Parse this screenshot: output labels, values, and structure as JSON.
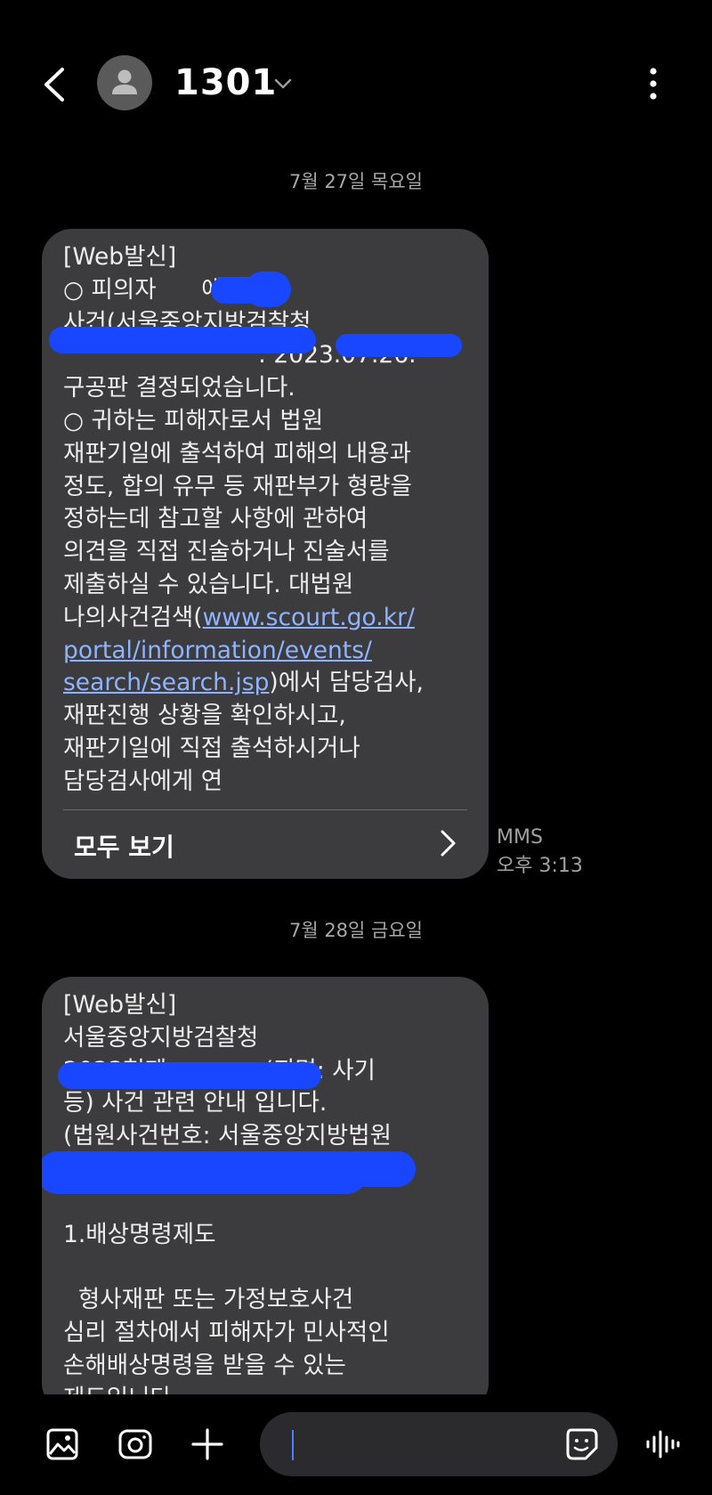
{
  "header": {
    "contact_name": "1301",
    "icons": {
      "back": "back-arrow-icon",
      "avatar": "person-icon",
      "expand": "chevron-down-icon",
      "more": "more-vertical-icon"
    }
  },
  "thread": [
    {
      "date": "7월 27일 목요일",
      "message": {
        "text_before_link": "[Web발신]\n○ 피의자      에 대한\n사건(서울중앙지방검찰청\n                          : 2023.07.26.\n구공판 결정되었습니다.\n○ 귀하는 피해자로서 법원\n재판기일에 출석하여 피해의 내용과\n정도, 합의 유무 등 재판부가 형량을\n정하는데 참고할 사항에 관하여\n의견을 직접 진술하거나 진술서를\n제출하실 수 있습니다. 대법원\n나의사건검색(",
        "link": "www.scourt.go.kr/\nportal/information/events/\nsearch/search.jsp",
        "text_after_link": ")에서 담당검사,\n재판진행 상황을 확인하시고,\n재판기일에 직접 출석하시거나\n담당검사에게 연",
        "see_all_label": "모두 보기",
        "type_label": "MMS",
        "time": "오후 3:13"
      }
    },
    {
      "date": "7월 28일 금요일",
      "message": {
        "text": "[Web발신]\n서울중앙지방검찰청\n2023형제             (죄명: 사기\n등) 사건 관련 안내 입니다.\n(법원사건번호: 서울중앙지방법원\n\n\n1.배상명령제도\n\n  형사재판 또는 가정보호사건\n심리 절차에서 피해자가 민사적인\n손해배상명령을 받을 수 있는\n제도입니다."
      }
    }
  ],
  "composer": {
    "placeholder": "",
    "icons": {
      "gallery": "gallery-icon",
      "camera": "camera-icon",
      "add": "plus-icon",
      "emoji": "sticker-emoji-icon",
      "voice": "voice-wave-icon"
    }
  },
  "colors": {
    "background": "#000000",
    "bubble": "#3c3c3e",
    "link": "#8fb4ff",
    "redaction": "#1947ff"
  }
}
